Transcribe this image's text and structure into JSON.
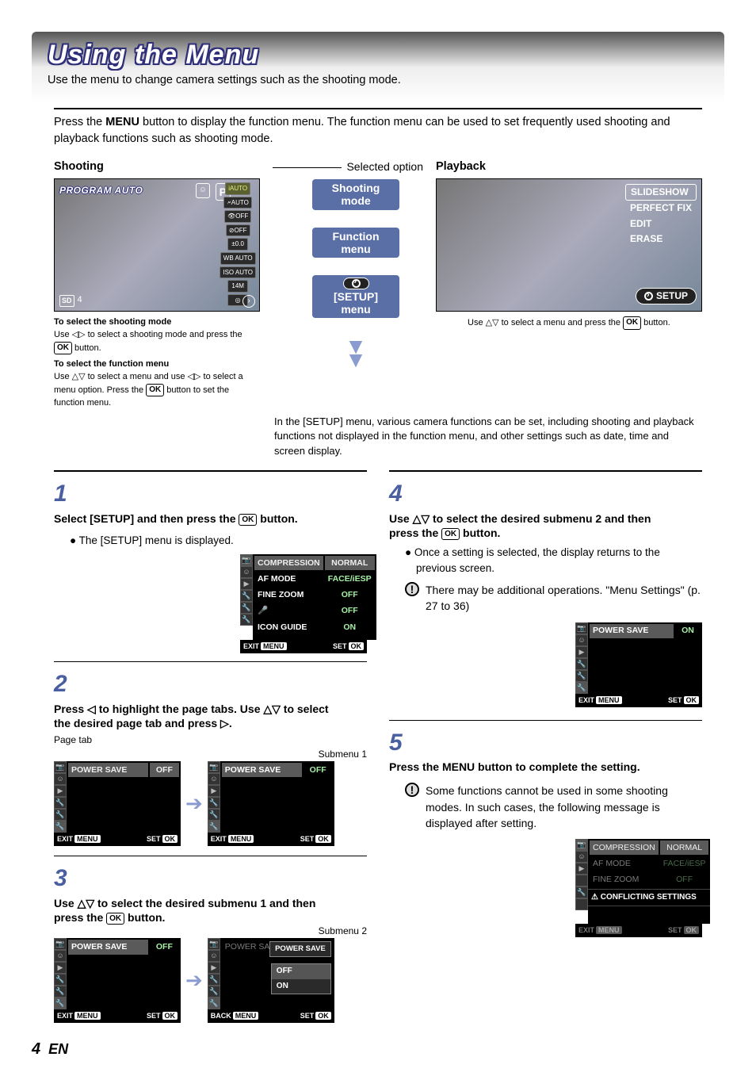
{
  "page": {
    "title": "Using the Menu",
    "subtitle": "Use the menu to change camera settings such as the shooting mode.",
    "intro_a": "Press the ",
    "intro_b": "MENU",
    "intro_c": " button to display the function menu. The function menu can be used to set frequently used shooting and playback functions such as shooting mode.",
    "number": "4",
    "lang": "EN"
  },
  "labels": {
    "shooting": "Shooting",
    "selected_option": "Selected option",
    "playback": "Playback",
    "shooting_mode": "Shooting mode",
    "function_menu": "Function menu",
    "setup_menu_a": "[SETUP]",
    "setup_menu_b": "menu",
    "setup_pill": "SETUP",
    "page_tab": "Page tab",
    "submenu1": "Submenu 1",
    "submenu2": "Submenu 2"
  },
  "shooting_screen": {
    "mode_label": "PROGRAM AUTO",
    "p_badge": "P",
    "iauto": "iAUTO",
    "side": [
      "🗲AUTO",
      "👁OFF",
      "⊘OFF",
      "±0.0",
      "WB AUTO",
      "ISO AUTO",
      "14M",
      "◎"
    ],
    "sd": "SD",
    "count": "4"
  },
  "playback_screen": {
    "items": [
      "SLIDESHOW",
      "PERFECT FIX",
      "EDIT",
      "ERASE"
    ]
  },
  "select_shooting": {
    "h": "To select the shooting mode",
    "a": "Use ◁▷ to select a shooting mode and press the ",
    "b": " button."
  },
  "select_function": {
    "h": "To select the function menu",
    "a": "Use △▽ to select a menu and use ◁▷ to select a menu option. Press the ",
    "b": " button to set the function menu."
  },
  "playback_note": {
    "a": "Use △▽ to select a menu and press the ",
    "b": " button."
  },
  "setup_para": "In the [SETUP] menu, various camera functions can be set, including shooting and playback functions not displayed in the function menu, and other settings such as date, time and screen display.",
  "steps": {
    "s1": {
      "num": "1",
      "text_a": "Select [SETUP] and then press the ",
      "text_b": " button.",
      "bullet": "● The [SETUP] menu is displayed."
    },
    "s2": {
      "num": "2",
      "text": "Press ◁ to highlight the page tabs. Use △▽ to select the desired page tab and press ▷."
    },
    "s3": {
      "num": "3",
      "text_a": "Use △▽ to select the desired submenu 1 and then press the ",
      "text_b": " button."
    },
    "s4": {
      "num": "4",
      "text_a": "Use △▽ to select the desired submenu 2 and then press the ",
      "text_b": " button.",
      "bullet": "● Once a setting is selected, the display returns to the previous screen.",
      "note": "There may be additional operations. \"Menu Settings\" (p. 27 to 36)"
    },
    "s5": {
      "num": "5",
      "text_a": "Press the ",
      "text_menu": "MENU",
      "text_b": " button to complete the setting.",
      "note": "Some functions cannot be used in some shooting modes. In such cases, the following message is displayed after setting."
    }
  },
  "lcd1": {
    "rows": [
      [
        "COMPRESSION",
        "NORMAL"
      ],
      [
        "AF MODE",
        "FACE/iESP"
      ],
      [
        "FINE ZOOM",
        "OFF"
      ],
      [
        "🎤",
        "OFF"
      ],
      [
        "ICON GUIDE",
        "ON"
      ]
    ],
    "exit": "EXIT",
    "menu": "MENU",
    "set": "SET",
    "ok": "OK"
  },
  "lcd_power": {
    "label": "POWER SAVE",
    "off": "OFF",
    "on": "ON",
    "exit": "EXIT",
    "menu": "MENU",
    "set": "SET",
    "back": "BACK",
    "ok": "OK"
  },
  "conflict": {
    "rows": [
      [
        "COMPRESSION",
        "NORMAL"
      ],
      [
        "AF MODE",
        "FACE/iESP"
      ],
      [
        "FINE ZOOM",
        "OFF"
      ]
    ],
    "warn": "⚠ CONFLICTING SETTINGS",
    "exit": "EXIT",
    "menu": "MENU",
    "set": "SET",
    "ok": "OK"
  }
}
